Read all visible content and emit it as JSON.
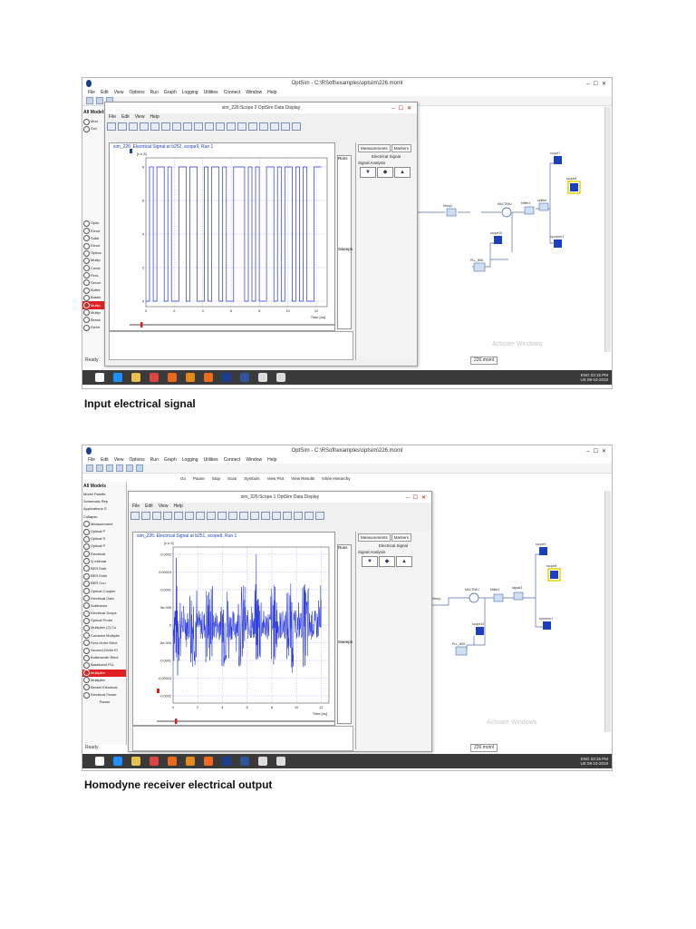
{
  "screens": [
    {
      "window_title": "OptSim - C:\\RSoft\\examples\\optsim\\226.moml",
      "menu": [
        "File",
        "Edit",
        "View",
        "Options",
        "Run",
        "Graph",
        "Logging",
        "Utilities",
        "Connect",
        "Window",
        "Help"
      ],
      "palette": [
        "All Models",
        "Mod",
        "Sch",
        "Optic",
        "Electr",
        "Subtr",
        "Electr",
        "Optica",
        "Multip",
        "Const",
        "First-",
        "Secon",
        "Butter",
        "Baseb",
        "Multip",
        "Multip",
        "Besse",
        "Electr"
      ],
      "display_title": "sim_226:Scope 2 OptSim Data Display",
      "display_menu": [
        "File",
        "Edit",
        "View",
        "Help"
      ],
      "signal_title": "sim_226: Electrical Signal at b252, scope9, Run 1",
      "y_exp": "[x e-3]",
      "y_ticks": [
        "8",
        "6",
        "4",
        "2",
        "0"
      ],
      "x_ticks": [
        "0",
        "2",
        "4",
        "6",
        "8",
        "10",
        "12"
      ],
      "x_label": "Time [ns]",
      "runs_label": "Runs",
      "sweeps_label": "Sweeps",
      "tabs": [
        "Measurements",
        "Markers"
      ],
      "panel_title": "Electrical Signal",
      "signal_analysis": "Signal Analysis",
      "status": "Ready",
      "file_tab": "226.moml",
      "watermark": "Activate Windows",
      "tray_time": "03:15 PM",
      "tray_date": "09-10-2018",
      "tray_lang": "ENG",
      "tray_region": "US",
      "schem_labels": [
        "scope7",
        "scope8",
        "MULTIMU",
        "bfilter1",
        "splitter",
        "hfreq1",
        "scope10",
        "PLL_BB1",
        "spcomm1"
      ]
    },
    {
      "window_title": "OptSim - C:\\RSoft\\examples\\optsim\\226.moml",
      "menu": [
        "File",
        "Edit",
        "View",
        "Options",
        "Run",
        "Graph",
        "Logging",
        "Utilities",
        "Connect",
        "Window",
        "Help"
      ],
      "toolbar_buttons": [
        "Go",
        "Pause",
        "Stop",
        "Scan",
        "Symbols",
        "View Plot",
        "View Results",
        "Inline Hierarchy"
      ],
      "palette_header": "All Models",
      "palette_tabs": [
        "Model Palette",
        "Schematic Rep",
        "Applications G"
      ],
      "palette_collapse": "Collapse",
      "palette": [
        "Measurement",
        "Optical P",
        "Optical S",
        "Optical P",
        "Electrical",
        "Q estimat",
        "BER Estir",
        "BER Estin",
        "BER Cou",
        "Optical Coupler",
        "Electrical Gain",
        "Subtractor",
        "Electrical Scope",
        "Optical Probe",
        "Multiplier (2) Co",
        "Constant Multiplie",
        "First-Order Elect",
        "Second-Order El",
        "Butterworth Elect",
        "Baseband PLL",
        "Multiplier",
        "Multiplier",
        "Bessel Electrical",
        "Electrical Power"
      ],
      "palette_footer": "Parser",
      "display_title": "sim_226:Scope 1 OptSim Data Display",
      "display_menu": [
        "File",
        "Edit",
        "View",
        "Help"
      ],
      "signal_title": "sim_226: Electrical Signal at b251, scope8, Run 1",
      "y_exp": "[x e-3]",
      "y_ticks": [
        "0.0002",
        "0.00015",
        "0.0001",
        "5e-005",
        "0",
        "-5e-005",
        "-0.0001",
        "-0.00015",
        "-0.0002"
      ],
      "x_ticks": [
        "0",
        "2",
        "4",
        "6",
        "8",
        "10",
        "12"
      ],
      "x_label": "Time [ns]",
      "runs_label": "Runs",
      "sweeps_label": "Sweeps",
      "tabs": [
        "Measurements",
        "Markers"
      ],
      "panel_title": "Electrical Signal",
      "signal_analysis": "Signal Analysis",
      "status": "Ready",
      "file_tab": "226.moml",
      "watermark": "Activate Windows",
      "tray_time": "03:16 PM",
      "tray_date": "09-10-2018",
      "tray_lang": "ENG",
      "tray_region": "US",
      "schem_labels": [
        "scope9",
        "scope8",
        "MULTIMU",
        "bfilter1",
        "signal3",
        "hfreq1",
        "scope10",
        "PLL_BB1",
        "spcomm1"
      ]
    }
  ],
  "captions": [
    "Input electrical signal",
    "Homodyne  receiver electrical output"
  ]
}
